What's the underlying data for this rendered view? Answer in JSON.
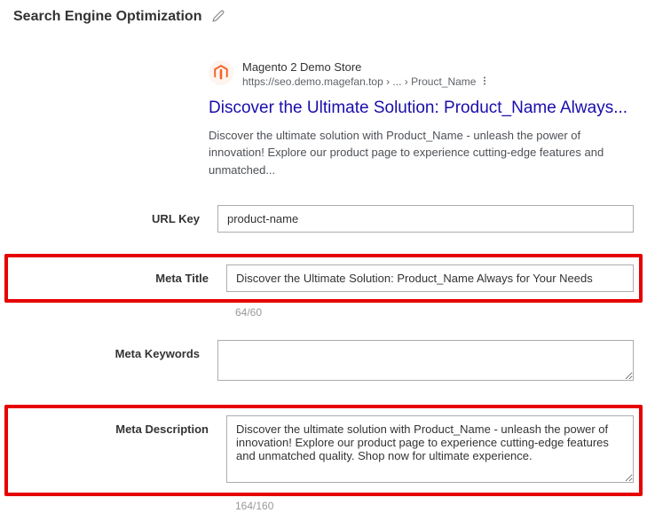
{
  "section": {
    "title": "Search Engine Optimization"
  },
  "preview": {
    "store_name": "Magento 2 Demo Store",
    "url_path": "https://seo.demo.magefan.top › ... › Prouct_Name",
    "title": "Discover the Ultimate Solution: Product_Name Always...",
    "description": "Discover the ultimate solution with Product_Name - unleash the power of innovation! Explore our product page to experience cutting-edge features and unmatched..."
  },
  "fields": {
    "url_key": {
      "label": "URL Key",
      "value": "product-name"
    },
    "meta_title": {
      "label": "Meta Title",
      "value": "Discover the Ultimate Solution: Product_Name Always for Your Needs",
      "counter": "64/60"
    },
    "meta_keywords": {
      "label": "Meta Keywords",
      "value": ""
    },
    "meta_description": {
      "label": "Meta Description",
      "value": "Discover the ultimate solution with Product_Name - unleash the power of innovation! Explore our product page to experience cutting-edge features and unmatched quality. Shop now for ultimate experience.",
      "counter": "164/160"
    }
  }
}
